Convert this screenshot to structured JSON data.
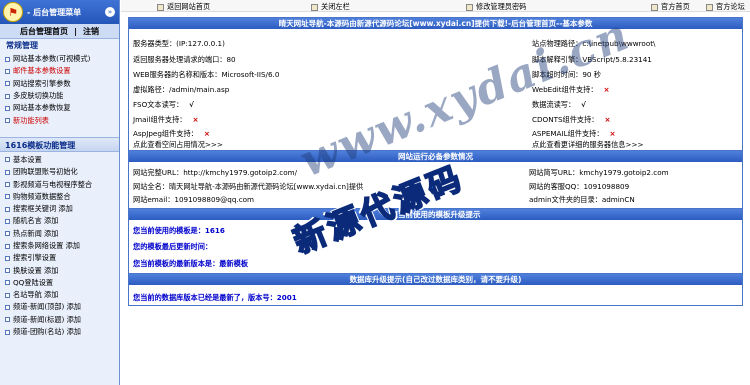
{
  "sidebar": {
    "logo_glyph": "⚑",
    "title": "- 后台管理菜单",
    "collapse_icon": "»",
    "link_home": "后台管理首页",
    "link_sep": "|",
    "link_logout": "注销",
    "section1": "常规管理",
    "section1_items": [
      {
        "label": "网站基本参数(可视模式)",
        "color": "#000000"
      },
      {
        "label": "邮件基本参数设置",
        "color": "#cc0000"
      },
      {
        "label": "网站搜索引擎参数",
        "color": "#000000"
      },
      {
        "label": "多皮肤切换功能",
        "color": "#000000"
      },
      {
        "label": "网站基本参数恢复",
        "color": "#000000"
      },
      {
        "label": "新功能列表",
        "color": "#cc0000"
      }
    ],
    "section2": "1616模板功能管理",
    "section2_items": [
      "基本设置",
      "团购联盟账号初始化",
      "影视频道与电视程序整合",
      "购物频道数据整合",
      "搜索框关键词  添加",
      "随机名言  添加",
      "热点新闻  添加",
      "搜索条网络设置  添加",
      "搜索引擎设置",
      "换肤设置  添加",
      "QQ登陆设置",
      "名站导航  添加",
      "频道-新闻(顶部)  添加",
      "频道-新闻(标题)  添加",
      "频道-团购(名站)  添加"
    ]
  },
  "topnav": {
    "back_home": "返回网站首页",
    "close_sidebar": "关闭左栏",
    "change_password": "修改管理员密码",
    "official_home": "官方首页",
    "official_forum": "官方论坛"
  },
  "box1": {
    "title": "晴天网址导航-本源码由新源代源码论坛[www.xydai.cn]提供下载!-后台管理首页--基本参数",
    "server_type": "服务器类型：(IP:127.0.0.1)",
    "site_path": "站点物理路径：c:\\inetpub\\wwwroot\\",
    "server_port": "返回服务器处理请求的端口：80",
    "script_engine": "脚本解释引擎：VBScript/5.8.23141",
    "web_server": "WEB服务器的名称和版本：Microsoft-IIS/6.0",
    "script_timeout": "脚本超时时间：90 秒",
    "virtual_dir": "虚拟路径：/admin/main.asp",
    "webedit": "WebEdit组件支持：",
    "fso": "FSO文本读写：",
    "data_stream": "数据流读写：",
    "jmail": "Jmail组件支持：",
    "cdonts": "CDONTS组件支持：",
    "aspjpeg": "AspJpeg组件支持：",
    "aspemail": "ASPEMAIL组件支持：",
    "view_space": "点此查看空间占用情况>>>",
    "view_more": "点此查看更详细的服务器信息>>>",
    "check_mark": "√",
    "cross_mark": "×"
  },
  "box2": {
    "title": "网站运行必备参数情况",
    "full_url": "网站完整URL：http://kmchy1979.gotoip2.com/",
    "short_url": "网站简写URL：kmchy1979.gotoip2.com",
    "full_name": "网站全名：晴天网址导航-本源码由新源代源码论坛[www.xydai.cn]提供",
    "service_qq": "网站的客服QQ：1091098809",
    "email": "网站email：1091098809@qq.com",
    "admin_file": "admin文件夹的目录：adminCN"
  },
  "box3": {
    "title": "您当前使用的模板升级提示",
    "line1": "您当前使用的模板是：1616",
    "line2": "您的模板最后更新时间：",
    "line3": "您当前模板的最新版本是：最新模板"
  },
  "box4": {
    "title": "数据库升级提示(自己改过数据库类别，请不要升级)",
    "line": "您当前的数据库版本已经是最新了，版本号：2001"
  },
  "overlay": {
    "watermark": "www.xydai.cn",
    "stamp": "新源代源码"
  }
}
